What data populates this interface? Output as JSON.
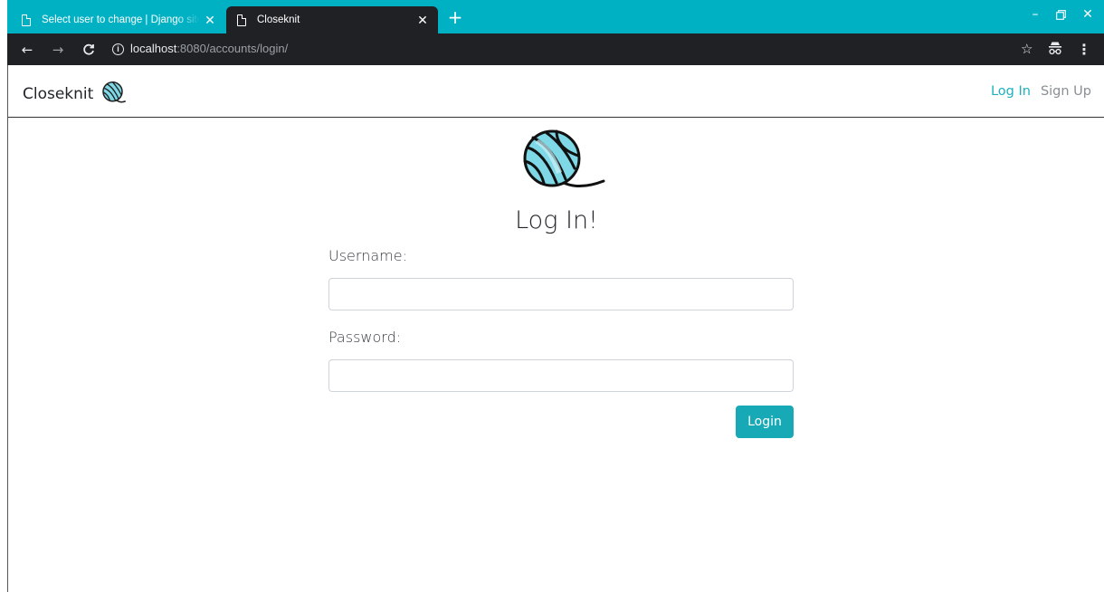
{
  "browser": {
    "tabs": [
      {
        "title": "Select user to change | Django site admin",
        "active": false
      },
      {
        "title": "Closeknit",
        "active": true
      }
    ],
    "url": {
      "host": "localhost",
      "rest": ":8080/accounts/login/"
    },
    "colors": {
      "tabstrip": "#00b1c4",
      "toolbar": "#202124"
    },
    "icons": {
      "page": "page-icon",
      "close": "close-icon",
      "new_tab": "plus-icon",
      "back": "back-arrow-icon",
      "forward": "forward-arrow-icon",
      "reload": "reload-icon",
      "info": "info-icon",
      "bookmark": "star-icon",
      "incognito": "incognito-icon",
      "menu": "kebab-menu-icon",
      "minimize": "minimize-icon",
      "restore": "restore-icon"
    }
  },
  "navbar": {
    "brand": "Closeknit",
    "links": {
      "login": "Log In",
      "signup": "Sign Up"
    },
    "colors": {
      "active_link": "#1cb1bd",
      "muted_link": "#8a8f95"
    }
  },
  "login_form": {
    "title": "Log In!",
    "username_label": "Username:",
    "username_value": "",
    "password_label": "Password:",
    "password_value": "",
    "submit_label": "Login",
    "colors": {
      "button": "#17a9b6",
      "yarn": "#7fd8e6",
      "yarn_dark": "#2aaec0"
    }
  }
}
